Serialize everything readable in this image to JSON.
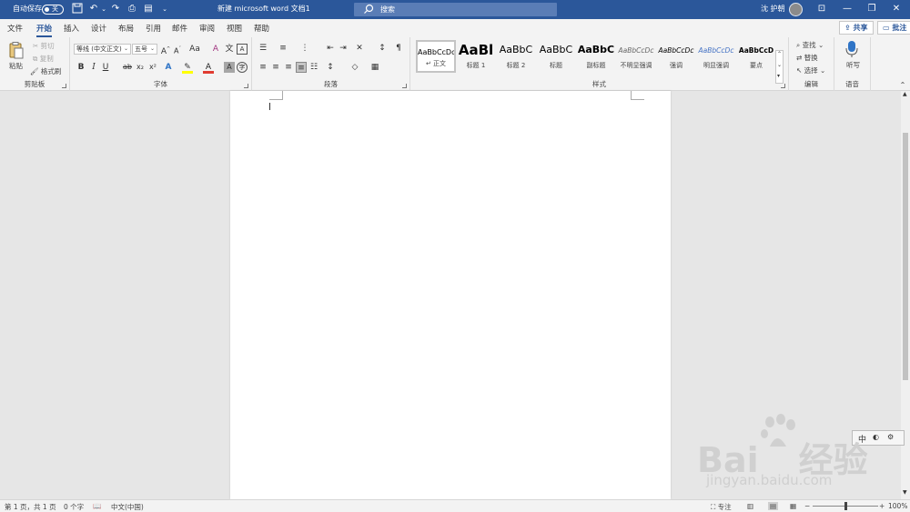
{
  "titlebar": {
    "autosave_label": "自动保存",
    "autosave_state": "关",
    "doc_title": "新建 microsoft word 文档1",
    "search_placeholder": "搜索",
    "user_name": "沈 护朝"
  },
  "tabs": [
    {
      "label": "文件"
    },
    {
      "label": "开始",
      "active": true
    },
    {
      "label": "插入"
    },
    {
      "label": "设计"
    },
    {
      "label": "布局"
    },
    {
      "label": "引用"
    },
    {
      "label": "邮件"
    },
    {
      "label": "审阅"
    },
    {
      "label": "视图"
    },
    {
      "label": "帮助"
    }
  ],
  "ribbon_actions": {
    "share": "共享",
    "comments": "批注"
  },
  "clipboard": {
    "paste": "粘贴",
    "cut": "剪切",
    "copy": "复制",
    "format_painter": "格式刷",
    "group_label": "剪贴板"
  },
  "font": {
    "font_name": "等线 (中文正文)",
    "font_size": "五号",
    "group_label": "字体",
    "change_case": "Aa"
  },
  "paragraph": {
    "group_label": "段落"
  },
  "styles": {
    "group_label": "样式",
    "items": [
      {
        "sample": "AaBbCcDc",
        "name": "正文",
        "selected": true
      },
      {
        "sample": "AaBl",
        "name": "标题 1"
      },
      {
        "sample": "AaBbC",
        "name": "标题 2"
      },
      {
        "sample": "AaBbC",
        "name": "标题"
      },
      {
        "sample": "AaBbC",
        "name": "副标题"
      },
      {
        "sample": "AaBbCcDc",
        "name": "不明显强调"
      },
      {
        "sample": "AaBbCcDc",
        "name": "强调"
      },
      {
        "sample": "AaBbCcDc",
        "name": "明显强调"
      },
      {
        "sample": "AaBbCcD",
        "name": "要点"
      }
    ]
  },
  "editing": {
    "find": "查找",
    "replace": "替换",
    "select": "选择",
    "group_label": "编辑"
  },
  "voice": {
    "dictate": "听写",
    "group_label": "语音"
  },
  "statusbar": {
    "page": "第 1 页，共 1 页",
    "words": "0 个字",
    "language": "中文(中国)",
    "focus": "专注",
    "zoom": "100%"
  },
  "watermark": {
    "brand": "Bai",
    "brand2": "经验",
    "url": "jingyan.baidu.com"
  },
  "ime": {
    "label": "中"
  },
  "colors": {
    "title_bar": "#2b579a",
    "accent": "#2b579a",
    "highlight": "#ffff00",
    "font_color": "#e03c31"
  }
}
